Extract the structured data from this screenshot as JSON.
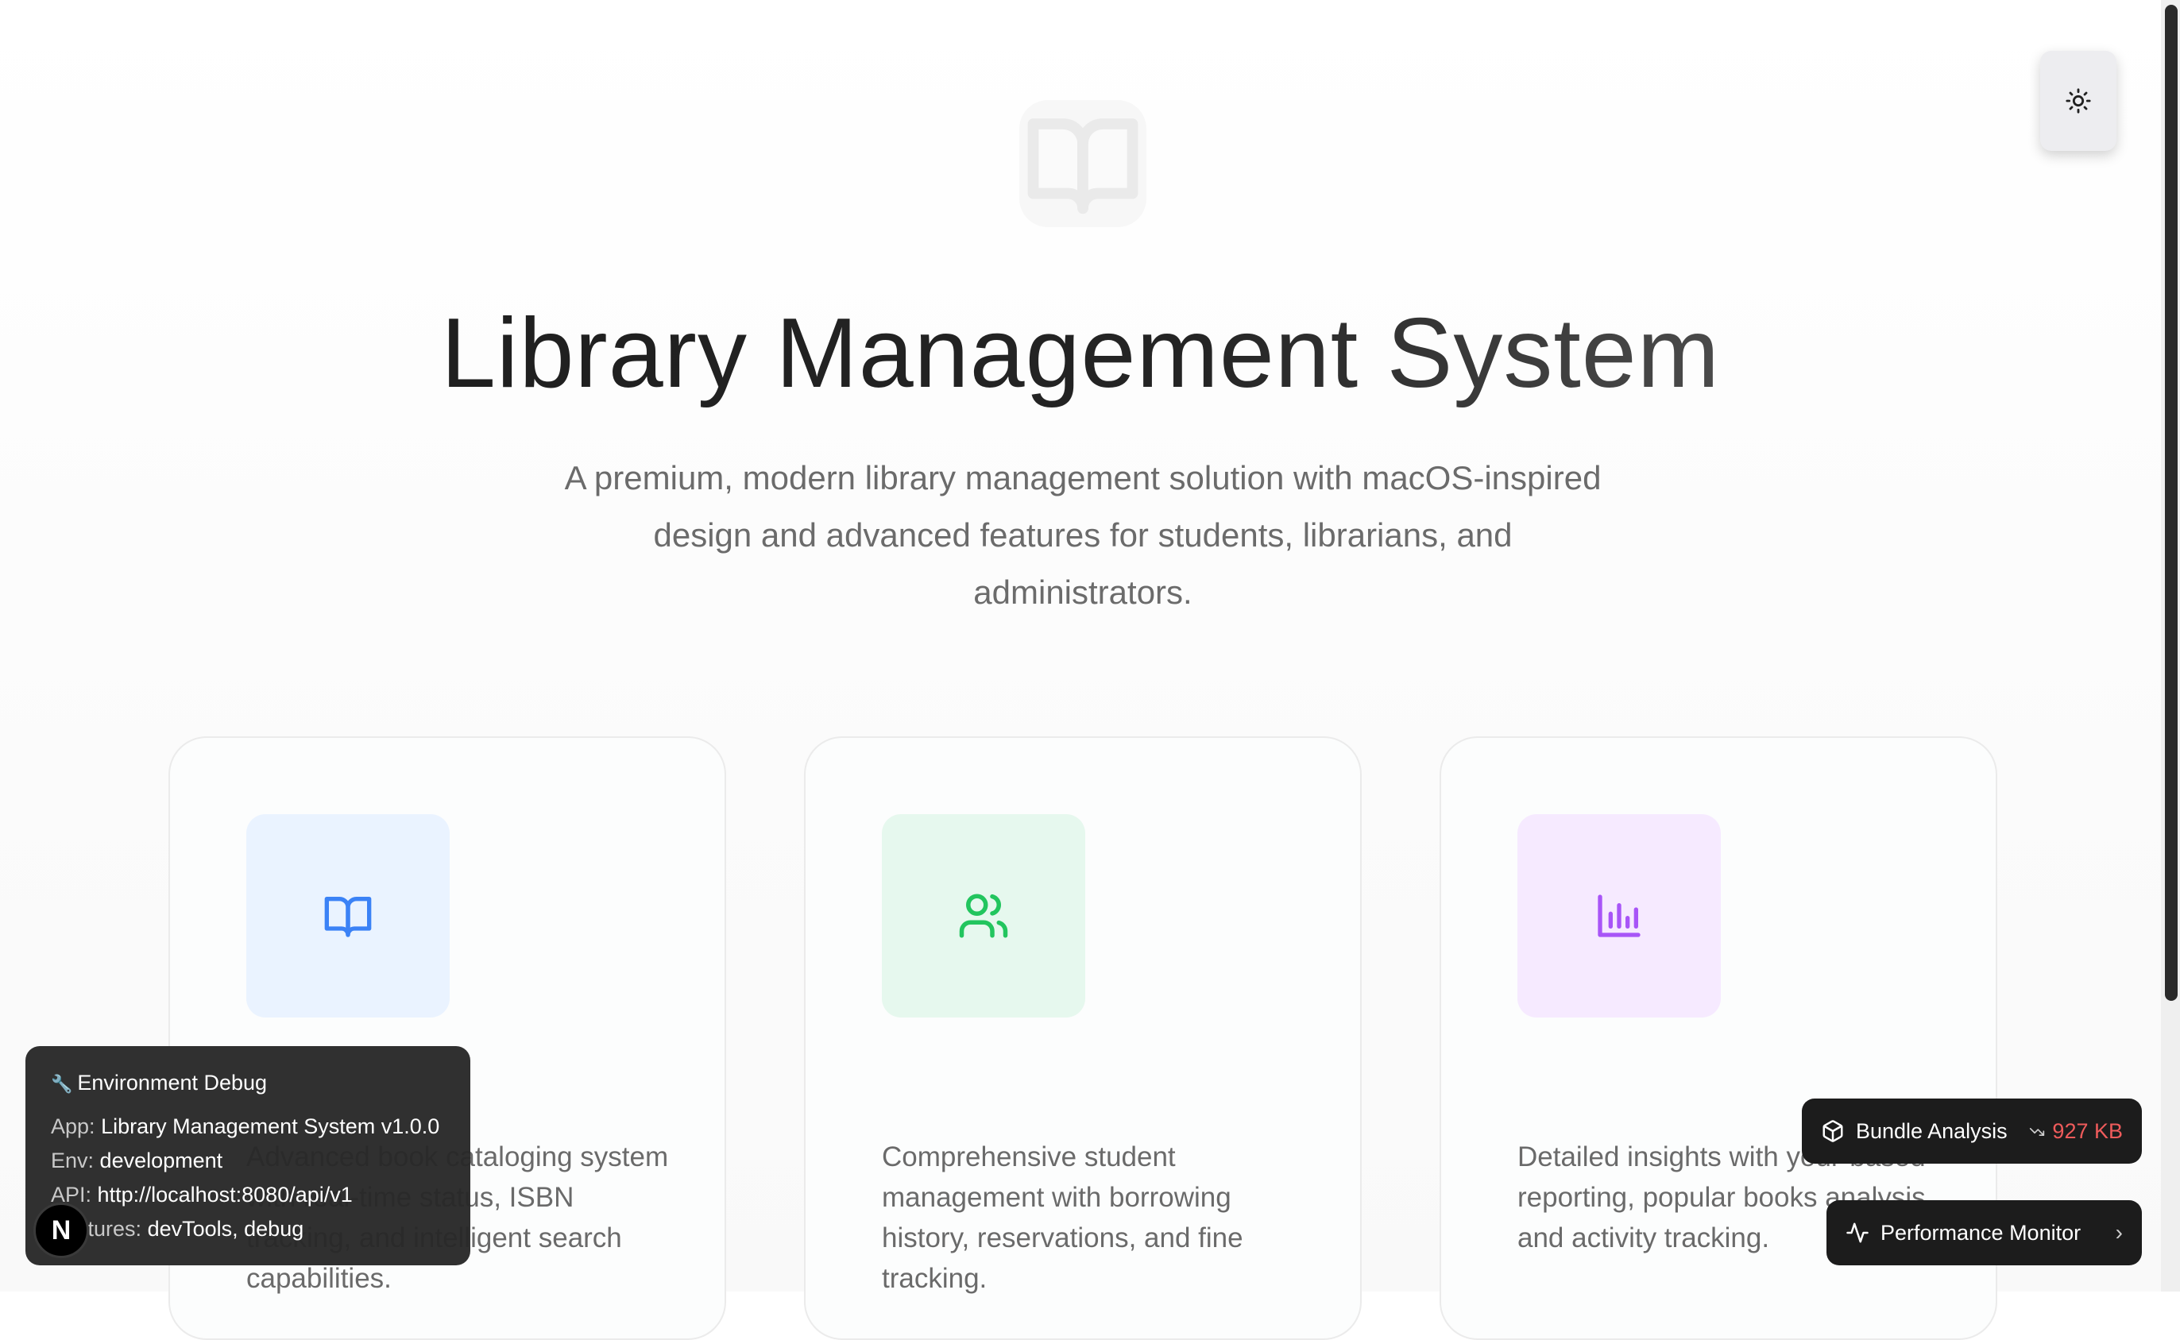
{
  "hero": {
    "logo_icon": "book-open-icon",
    "title": "Library Management System",
    "subtitle": "A premium, modern library management solution with macOS-inspired design and advanced features for students, librarians, and administrators."
  },
  "features": [
    {
      "icon": "book-open-icon",
      "icon_color": "#3b82f6",
      "bg_color": "#eaf3ff",
      "description": "Advanced book cataloging system with real-time status, ISBN tracking, and intelligent search capabilities."
    },
    {
      "icon": "users-icon",
      "icon_color": "#22c55e",
      "bg_color": "#e6f8ee",
      "description": "Comprehensive student management with borrowing history, reservations, and fine tracking."
    },
    {
      "icon": "bar-chart-icon",
      "icon_color": "#a855f7",
      "bg_color": "#f6eaff",
      "description": "Detailed insights with your-based reporting, popular books analysis, and activity tracking."
    }
  ],
  "theme_toggle": {
    "icon": "sun-icon"
  },
  "debug": {
    "title": "Environment Debug",
    "icon": "wrench-icon",
    "app_label": "App:",
    "app_value": "Library Management System v1.0.0",
    "env_label": "Env:",
    "env_value": "development",
    "api_label": "API:",
    "api_value": "http://localhost:8080/api/v1",
    "features_label": "Features:",
    "features_value": "devTools, debug"
  },
  "next_badge": {
    "letter": "N"
  },
  "bundle": {
    "icon": "package-icon",
    "label": "Bundle Analysis",
    "trend_icon": "trending-down-icon",
    "size": "927 KB",
    "size_color": "#ef5b5b"
  },
  "performance": {
    "icon": "activity-icon",
    "label": "Performance Monitor",
    "chevron": "›"
  }
}
